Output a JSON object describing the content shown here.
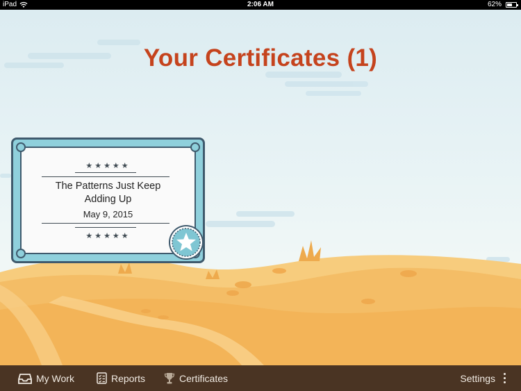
{
  "status_bar": {
    "carrier": "iPad",
    "time": "2:06 AM",
    "battery_percent": "62%",
    "battery_level": 0.62,
    "icons": [
      "wifi-icon",
      "battery-icon"
    ]
  },
  "main": {
    "title": "Your Certificates (1)"
  },
  "certificates": [
    {
      "name_line1": "The Patterns Just Keep",
      "name_line2": "Adding Up",
      "date": "May 9, 2015",
      "stars": "★★★★★",
      "seal_icon": "star-seal-icon"
    }
  ],
  "tab_bar": {
    "my_work": {
      "label": "My Work",
      "icon": "inbox-tray-icon"
    },
    "reports": {
      "label": "Reports",
      "icon": "checklist-icon"
    },
    "certificates": {
      "label": "Certificates",
      "icon": "trophy-icon"
    },
    "settings": {
      "label": "Settings",
      "icon": "more-vertical-icon"
    }
  },
  "colors": {
    "title": "#c5431d",
    "card_frame": "#8fd0dc",
    "card_border": "#3f5a6d",
    "tab_bar": "#4a3423",
    "hills": "#f3b85e"
  }
}
